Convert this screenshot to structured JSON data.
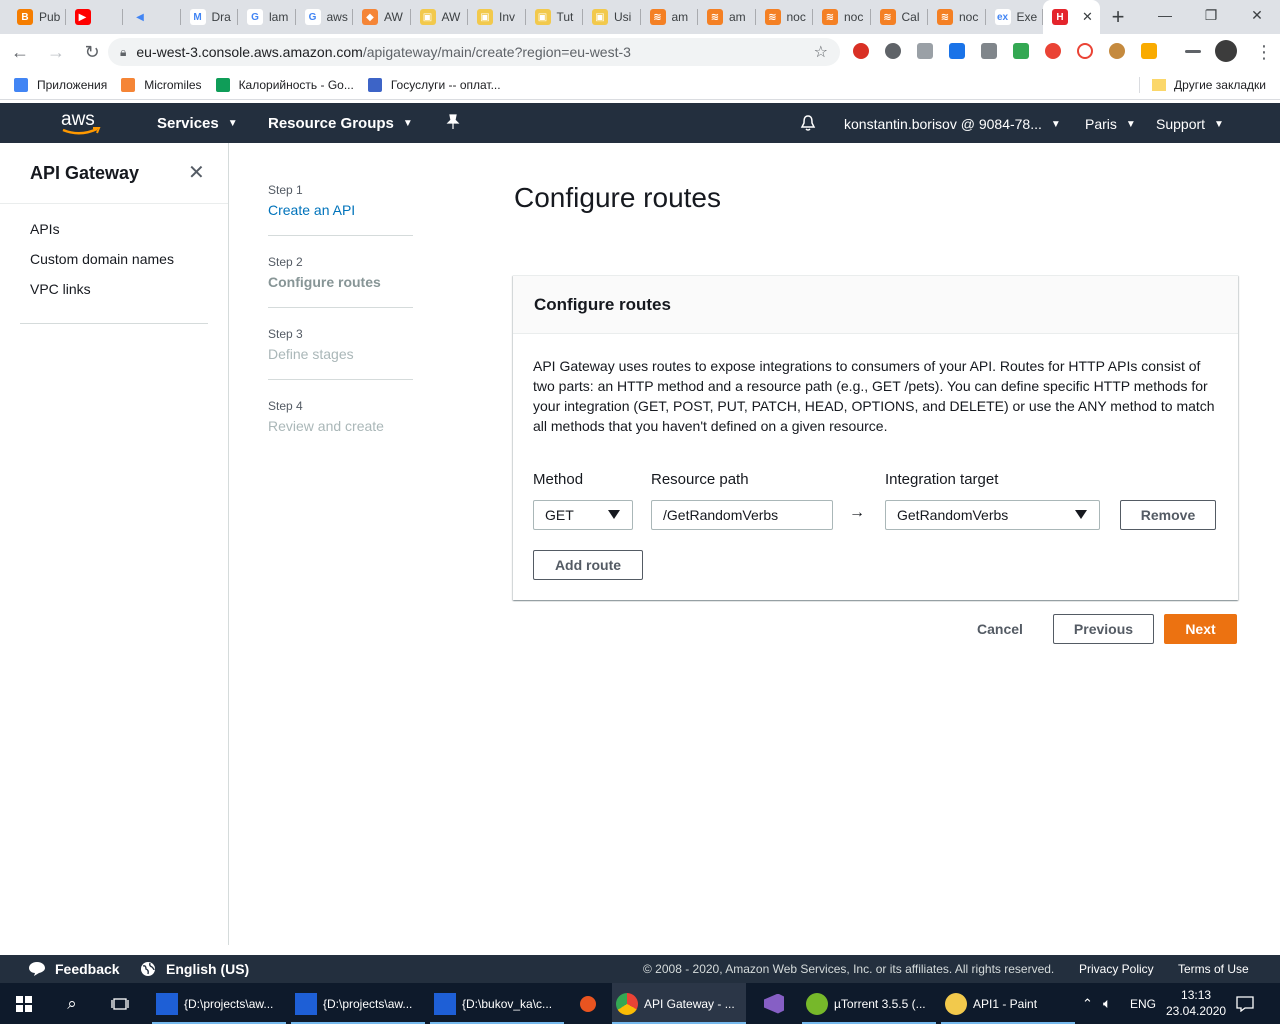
{
  "browser": {
    "tabs": [
      {
        "label": "Pub",
        "color": "#f57d00",
        "glyph": "B"
      },
      {
        "label": "",
        "color": "#ff0000",
        "glyph": "▶"
      },
      {
        "label": "",
        "color": "#dee1e6",
        "glyph": "◀"
      },
      {
        "label": "Dra",
        "color": "#ffffff",
        "glyph": "M"
      },
      {
        "label": "lam",
        "color": "#ffffff",
        "glyph": "G"
      },
      {
        "label": "aws",
        "color": "#ffffff",
        "glyph": "G"
      },
      {
        "label": "AW",
        "color": "#f58536",
        "glyph": "◆"
      },
      {
        "label": "AW",
        "color": "#f2c94c",
        "glyph": "▣"
      },
      {
        "label": "Inv",
        "color": "#f2c94c",
        "glyph": "▣"
      },
      {
        "label": "Tut",
        "color": "#f2c94c",
        "glyph": "▣"
      },
      {
        "label": "Usi",
        "color": "#f2c94c",
        "glyph": "▣"
      },
      {
        "label": "am",
        "color": "#f48024",
        "glyph": "≋"
      },
      {
        "label": "am",
        "color": "#f48024",
        "glyph": "≋"
      },
      {
        "label": "noc",
        "color": "#f48024",
        "glyph": "≋"
      },
      {
        "label": "noc",
        "color": "#f48024",
        "glyph": "≋"
      },
      {
        "label": "Cal",
        "color": "#f48024",
        "glyph": "≋"
      },
      {
        "label": "noc",
        "color": "#f48024",
        "glyph": "≋"
      },
      {
        "label": "Exe",
        "color": "#ffffff",
        "glyph": "ex"
      },
      {
        "label": "",
        "color": "#e4252c",
        "glyph": "H"
      }
    ],
    "url_host": "eu-west-3.console.aws.amazon.com",
    "url_path": "/apigateway/main/create?region=eu-west-3",
    "bookmarks": [
      {
        "label": "Приложения",
        "color": "#4285f4"
      },
      {
        "label": "Micromiles",
        "color": "#f58536"
      },
      {
        "label": "Калорийность - Go...",
        "color": "#0f9d58"
      },
      {
        "label": "Госуслуги -- оплат...",
        "color": "#3d64c7"
      }
    ],
    "bookmarks_other": "Другие закладки"
  },
  "aws": {
    "nav": {
      "services": "Services",
      "resource_groups": "Resource Groups",
      "account": "konstantin.borisov @ 9084-78...",
      "region": "Paris",
      "support": "Support"
    },
    "sidebar": {
      "title": "API Gateway",
      "items": [
        "APIs",
        "Custom domain names",
        "VPC links"
      ]
    },
    "steps": [
      {
        "num": "Step 1",
        "name": "Create an API"
      },
      {
        "num": "Step 2",
        "name": "Configure routes"
      },
      {
        "num": "Step 3",
        "name": "Define stages"
      },
      {
        "num": "Step 4",
        "name": "Review and create"
      }
    ],
    "page_title": "Configure routes",
    "panel": {
      "header": "Configure routes",
      "description": "API Gateway uses routes to expose integrations to consumers of your API. Routes for HTTP APIs consist of two parts: an HTTP method and a resource path (e.g., GET /pets). You can define specific HTTP methods for your integration (GET, POST, PUT, PATCH, HEAD, OPTIONS, and DELETE) or use the ANY method to match all methods that you haven't defined on a given resource.",
      "method_label": "Method",
      "path_label": "Resource path",
      "target_label": "Integration target",
      "method_value": "GET",
      "path_value": "/GetRandomVerbs",
      "target_value": "GetRandomVerbs",
      "arrow": "→",
      "remove_label": "Remove",
      "add_route_label": "Add route"
    },
    "actions": {
      "cancel": "Cancel",
      "previous": "Previous",
      "next": "Next"
    },
    "footer": {
      "feedback": "Feedback",
      "language": "English (US)",
      "copyright": "© 2008 - 2020, Amazon Web Services, Inc. or its affiliates. All rights reserved.",
      "privacy": "Privacy Policy",
      "terms": "Terms of Use"
    }
  },
  "taskbar": {
    "apps": [
      {
        "label": "{D:\\projects\\aw...",
        "color": "#1e5fd6"
      },
      {
        "label": "{D:\\projects\\aw...",
        "color": "#1e5fd6"
      },
      {
        "label": "{D:\\bukov_ka\\c...",
        "color": "#1e5fd6"
      },
      {
        "label": "API Gateway - ...",
        "color": "#ea4335"
      },
      {
        "label": "µTorrent 3.5.5  (...",
        "color": "#76b82a"
      },
      {
        "label": "API1 - Paint",
        "color": "#f2c94c"
      }
    ],
    "lang": "ENG",
    "time": "13:13",
    "date": "23.04.2020"
  }
}
